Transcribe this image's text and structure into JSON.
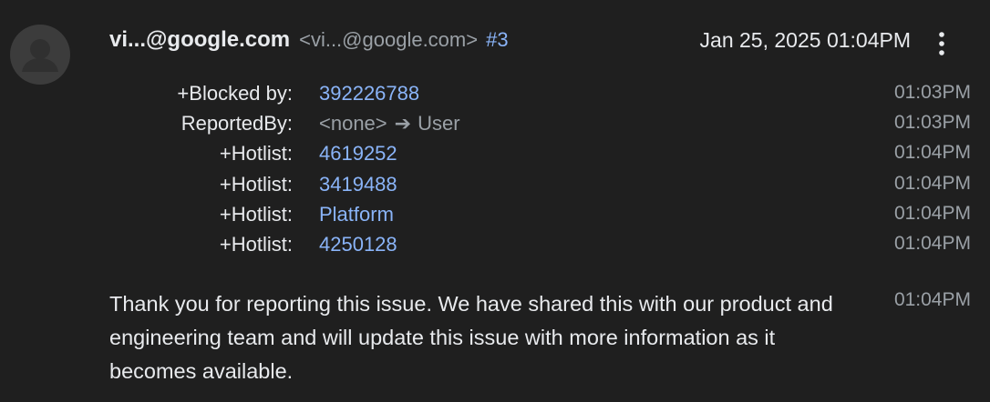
{
  "comment": {
    "author_name": "vi...@google.com",
    "author_email": "<vi...@google.com>",
    "comment_number": "#3",
    "date": "Jan 25, 2025 01:04PM",
    "menu_icon": "more-vert-icon",
    "avatar_icon": "person-icon"
  },
  "changes": [
    {
      "label": "+Blocked by:",
      "value": "392226788",
      "time": "01:03PM"
    },
    {
      "label": "ReportedBy:",
      "old_value": "<none>",
      "arrow": "➔",
      "new_value": "User",
      "time": "01:03PM"
    },
    {
      "label": "+Hotlist:",
      "value": "4619252",
      "time": "01:04PM"
    },
    {
      "label": "+Hotlist:",
      "value": "3419488",
      "time": "01:04PM"
    },
    {
      "label": "+Hotlist:",
      "value": "Platform",
      "time": "01:04PM"
    },
    {
      "label": "+Hotlist:",
      "value": "4250128",
      "time": "01:04PM"
    }
  ],
  "body": {
    "text": "Thank you for reporting this issue. We have shared this with our product and engineering team and will update this issue with more information as it becomes available.",
    "time": "01:04PM"
  },
  "colors": {
    "background": "#1f1f1f",
    "text": "#e8eaed",
    "muted": "#9aa0a6",
    "link": "#8ab4f8",
    "avatar": "#3c3c3c"
  }
}
